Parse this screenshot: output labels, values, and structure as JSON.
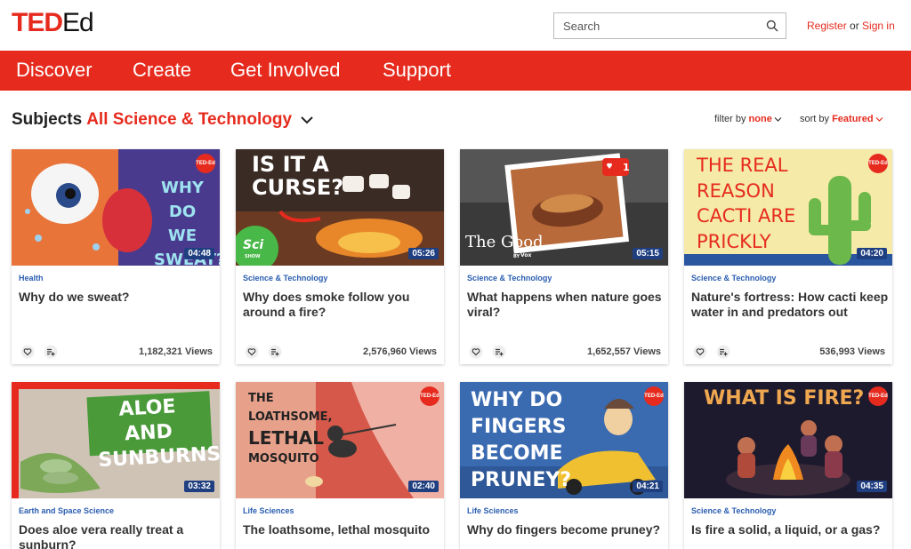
{
  "header": {
    "logo_ted": "TED",
    "logo_ed": "Ed",
    "search_placeholder": "Search",
    "register": "Register",
    "or": "or",
    "signin": "Sign in"
  },
  "nav": [
    "Discover",
    "Create",
    "Get Involved",
    "Support"
  ],
  "subjects": {
    "label": "Subjects",
    "selected": "All Science & Technology"
  },
  "filters": {
    "filter_label": "filter by",
    "filter_value": "none",
    "sort_label": "sort by",
    "sort_value": "Featured"
  },
  "badge_text": "TED-Ed",
  "cards": [
    {
      "category": "Health",
      "title": "Why do we sweat?",
      "duration": "04:48",
      "views": "1,182,321 Views",
      "thumb_text": [
        "WHY",
        "DO WE",
        "SWEAT?"
      ]
    },
    {
      "category": "Science & Technology",
      "title": "Why does smoke follow you around a fire?",
      "duration": "05:26",
      "views": "2,576,960 Views",
      "thumb_text": [
        "IS IT A",
        "CURSE?",
        "Sci",
        "SHOW"
      ]
    },
    {
      "category": "Science & Technology",
      "title": "What happens when nature goes viral?",
      "duration": "05:15",
      "views": "1,652,557 Views",
      "thumb_text": [
        "The Good",
        "BY",
        "Vox",
        "1"
      ]
    },
    {
      "category": "Science & Technology",
      "title": "Nature's fortress: How cacti keep water in and predators out",
      "duration": "04:20",
      "views": "536,993 Views",
      "thumb_text": [
        "THE REAL",
        "REASON",
        "CACTI ARE",
        "PRICKLY"
      ]
    },
    {
      "category": "Earth and Space Science",
      "title": "Does aloe vera really treat a sunburn?",
      "duration": "03:32",
      "views": "",
      "thumb_text": [
        "ALOE AND",
        "SUNBURNS"
      ]
    },
    {
      "category": "Life Sciences",
      "title": "The loathsome, lethal mosquito",
      "duration": "02:40",
      "views": "",
      "thumb_text": [
        "THE",
        "LOATHSOME,",
        "LETHAL",
        "MOSQUITO"
      ]
    },
    {
      "category": "Life Sciences",
      "title": "Why do fingers become pruney?",
      "duration": "04:21",
      "views": "",
      "thumb_text": [
        "WHY DO",
        "FINGERS",
        "BECOME",
        "PRUNEY?"
      ]
    },
    {
      "category": "Science & Technology",
      "title": "Is fire a solid, a liquid, or a gas?",
      "duration": "04:35",
      "views": "",
      "thumb_text": [
        "WHAT IS FIRE?"
      ]
    }
  ],
  "colors": {
    "brand_red": "#e62b1e",
    "category_blue": "#2a5db0",
    "duration_bg": "#1f3f80"
  }
}
